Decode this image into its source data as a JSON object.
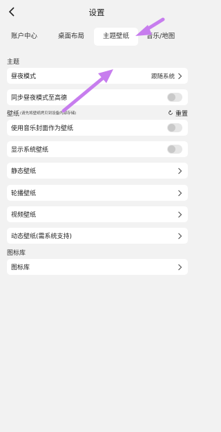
{
  "header": {
    "title": "设置"
  },
  "tabs": [
    {
      "label": "账户中心"
    },
    {
      "label": "桌面布局"
    },
    {
      "label": "主题壁纸"
    },
    {
      "label": "音乐/地图"
    }
  ],
  "sections": {
    "theme": "主题",
    "wallpaper_title": "壁纸",
    "wallpaper_note": "(请先将壁纸拷贝到设备内部存储)",
    "reset_label": "重置",
    "icons": "图标库"
  },
  "rows": {
    "day_night_mode": {
      "label": "昼夜模式",
      "value": "跟随系统"
    },
    "sync_amap": {
      "label": "同步昼夜模式至高德",
      "on": false
    },
    "music_cover": {
      "label": "使用音乐封面作为壁纸",
      "on": false
    },
    "system_wallpaper": {
      "label": "显示系统壁纸",
      "on": false
    },
    "static_wallpaper": {
      "label": "静态壁纸"
    },
    "carousel_wallpaper": {
      "label": "轮播壁纸"
    },
    "video_wallpaper": {
      "label": "视频壁纸"
    },
    "dynamic_wallpaper": {
      "label": "动态壁纸(需系统支持)"
    },
    "icon_library": {
      "label": "图标库"
    }
  },
  "colors": {
    "annotation_arrow": "#c77dee",
    "background": "#f2f2f2",
    "card": "#ffffff"
  }
}
